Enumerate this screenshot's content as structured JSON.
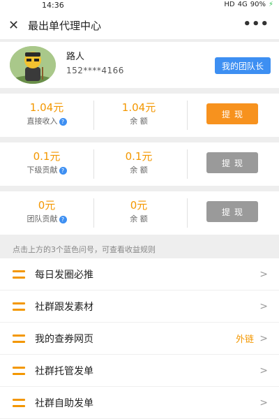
{
  "status": {
    "time": "14:36",
    "hd": "HD",
    "signal": "4G",
    "battery": "90%"
  },
  "nav": {
    "close": "✕",
    "title": "最出单代理中心",
    "more": "•••"
  },
  "profile": {
    "name": "路人",
    "phone": "152****4166",
    "team_button": "我的团队长"
  },
  "cards": [
    {
      "left_amount": "1.04元",
      "left_label": "直接收入",
      "mid_amount": "1.04元",
      "mid_label": "余 额",
      "withdraw": "提现",
      "state": "active"
    },
    {
      "left_amount": "0.1元",
      "left_label": "下级贡献",
      "mid_amount": "0.1元",
      "mid_label": "余 额",
      "withdraw": "提现",
      "state": "disabled"
    },
    {
      "left_amount": "0元",
      "left_label": "团队贡献",
      "mid_amount": "0元",
      "mid_label": "余 额",
      "withdraw": "提现",
      "state": "disabled"
    }
  ],
  "hint": "点击上方的3个蓝色问号，可查看收益规则",
  "menu": [
    {
      "label": "每日发圈必推",
      "extra": ""
    },
    {
      "label": "社群跟发素材",
      "extra": ""
    },
    {
      "label": "我的查券网页",
      "extra": "外链"
    },
    {
      "label": "社群托管发单",
      "extra": ""
    },
    {
      "label": "社群自助发单",
      "extra": ""
    }
  ],
  "colors": {
    "accent": "#f39700",
    "blue": "#3d8ff2",
    "disabled": "#9a9a9a"
  }
}
